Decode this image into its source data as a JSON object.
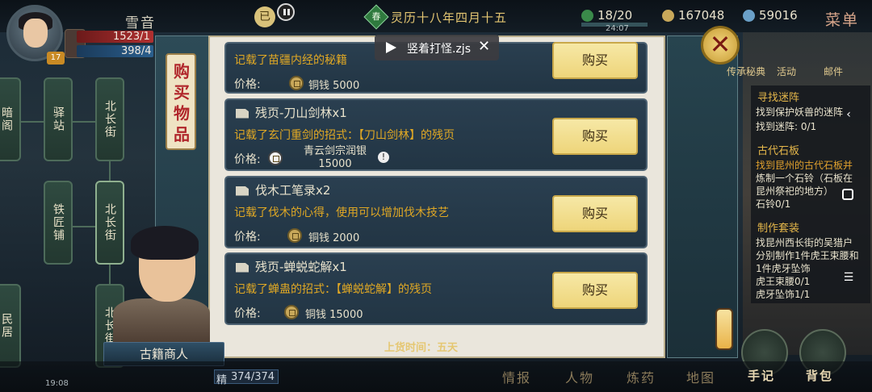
{
  "player": {
    "name": "雪音",
    "hp": "1523/1",
    "mp": "398/4",
    "level": "17"
  },
  "top": {
    "season_glyph": "已",
    "date_glyph": "春",
    "date": "灵历十八年四月十五",
    "stamina": "18/20",
    "stamina_timer": "24:07",
    "copper": "167048",
    "silver": "59016",
    "menu": "菜单"
  },
  "map": {
    "nodes": [
      "暗阁",
      "驿站",
      "北长街",
      "铁匠铺",
      "北长街",
      "民居",
      "北长街"
    ]
  },
  "shop": {
    "tab_label": "购买物品",
    "price_label": "价格:",
    "buy_label": "购买",
    "items": [
      {
        "title": "",
        "desc": "记载了苗疆内经的秘籍",
        "price": "铜钱 5000"
      },
      {
        "title": "残页-刀山剑林x1",
        "desc": "记载了玄门重剑的招式：【刀山剑林】的残页",
        "price": "青云剑宗润银 15000"
      },
      {
        "title": "伐木工笔录x2",
        "desc": "记载了伐木的心得，使用可以增加伐木技艺",
        "price": "铜钱 2000"
      },
      {
        "title": "残页-蝉蜕蛇解x1",
        "desc": "记载了蝉蛊的招式：【蝉蜕蛇解】的残页",
        "price": "铜钱 15000"
      }
    ],
    "restock": "上货时间：五天"
  },
  "video": {
    "filename": "竖着打怪.zjs"
  },
  "close_icon": "close-icon",
  "top_icons": [
    "传承秘典",
    "活动",
    "邮件"
  ],
  "quests": [
    {
      "title": "寻找迷阵",
      "lines": [
        "找到保护妖兽的迷阵",
        "找到迷阵: 0/1"
      ]
    },
    {
      "title": "古代石板",
      "lines": [
        "找到昆州的古代石板并",
        "炼制一个石铃（石板在",
        "昆州祭祀的地方）",
        "石铃0/1"
      ]
    },
    {
      "title": "制作套装",
      "lines": [
        "找昆州西长街的吴猎户",
        "分别制作1件虎王束腰和",
        "1件虎牙坠饰",
        "虎王束腰0/1",
        "虎牙坠饰1/1"
      ]
    }
  ],
  "merchant": {
    "name": "古籍商人"
  },
  "bottom": {
    "clock": "19:08",
    "energy_label": "精",
    "energy": "374/374",
    "items": [
      "情报",
      "人物",
      "炼药",
      "地图",
      "手记",
      "背包"
    ]
  }
}
